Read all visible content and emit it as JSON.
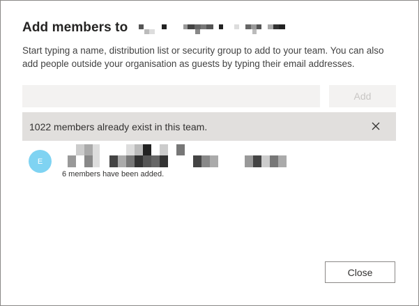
{
  "dialog": {
    "title": "Add members to",
    "description": "Start typing a name, distribution list or security group to add to your team. You can also add people outside your organisation as guests by typing their email addresses.",
    "search": {
      "value": "",
      "placeholder": ""
    },
    "add_label": "Add",
    "notice": {
      "text": "1022 members already exist in this team.",
      "dismiss_icon": "close-icon"
    },
    "member": {
      "avatar_initial": "E",
      "avatar_color": "#7fd3f2",
      "status": "6 members have been added."
    },
    "close_label": "Close"
  },
  "colors": {
    "notice_bg": "#e1dfdd",
    "input_bg": "#f3f2f1",
    "add_disabled_text": "#c8c6c4",
    "border": "#8a8886"
  }
}
